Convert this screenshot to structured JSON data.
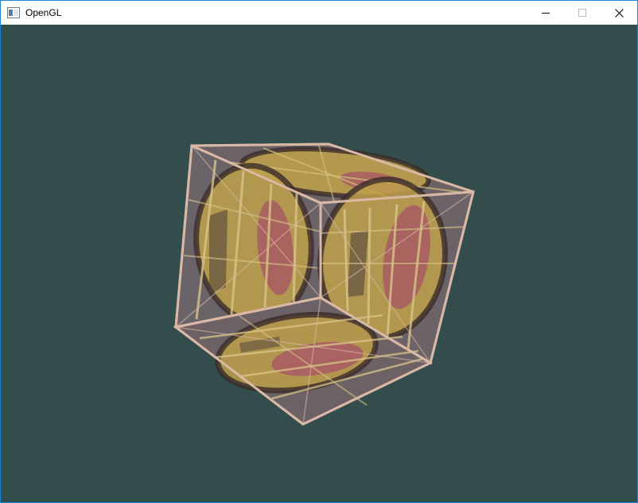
{
  "window": {
    "title": "OpenGL"
  },
  "title_bar": {
    "app_icon": "window-app-icon",
    "controls": [
      {
        "name": "minimize",
        "icon": "minimize-icon"
      },
      {
        "name": "maximize",
        "icon": "maximize-icon"
      },
      {
        "name": "close",
        "icon": "close-icon"
      }
    ]
  },
  "scene": {
    "clear_color": "#334d4d",
    "object": "textured-cube",
    "texture": "wooden-container-with-awesomeface",
    "colors": {
      "wood": "#6b5f63",
      "face_yellow": "#c9ad4e",
      "face_outline": "#3a2c2a",
      "mouth_red": "#a85a64",
      "edge_highlight": "#d9b8a6"
    }
  }
}
